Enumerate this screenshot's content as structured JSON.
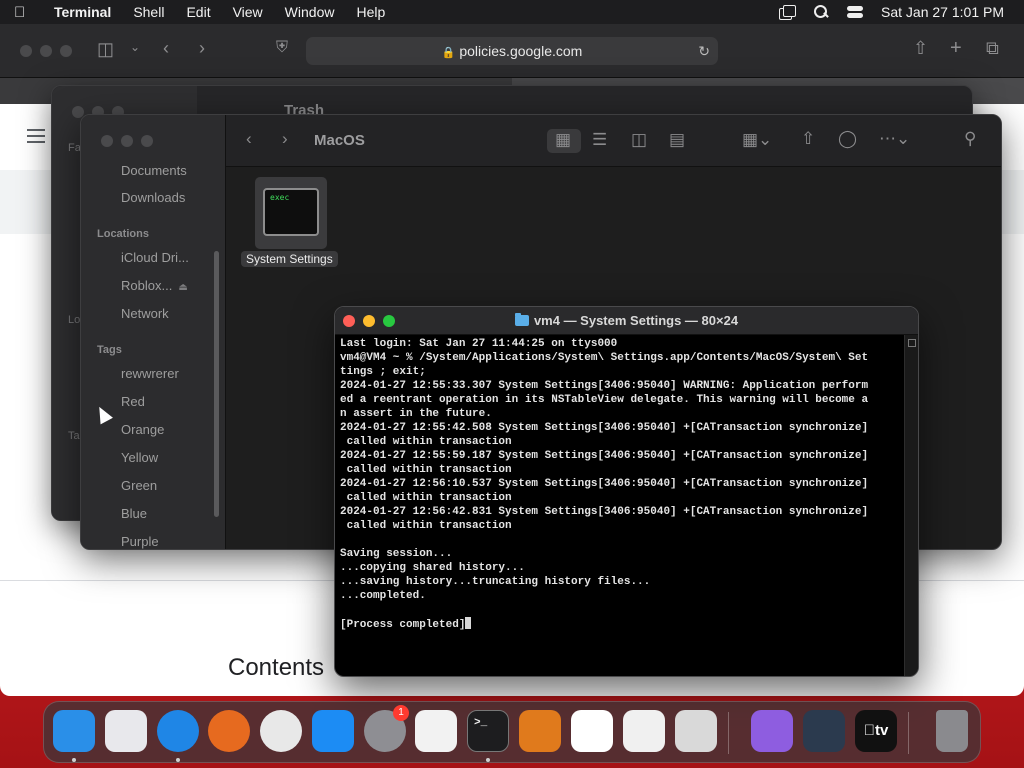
{
  "menubar": {
    "app_name": "Terminal",
    "menus": [
      "Shell",
      "Edit",
      "View",
      "Window",
      "Help"
    ],
    "clock": "Sat Jan 27  1:01 PM"
  },
  "safari": {
    "url": "policies.google.com",
    "contents_heading": "Contents"
  },
  "finder_back": {
    "title": "Trash",
    "sidebar_fragments": [
      "Fa",
      "Lo",
      "Ta"
    ]
  },
  "finder_front": {
    "title": "MacOS",
    "sidebar": {
      "favorites": [
        "Documents",
        "Downloads"
      ],
      "locations_header": "Locations",
      "locations": [
        "iCloud Dri...",
        "Roblox...",
        "Network"
      ],
      "tags_header": "Tags",
      "tags": [
        "rewwrerer",
        "Red",
        "Orange",
        "Yellow",
        "Green",
        "Blue",
        "Purple"
      ]
    },
    "file": {
      "icon_text": "exec",
      "name": "System Settings"
    }
  },
  "terminal": {
    "title": "vm4 — System Settings — 80×24",
    "lines": [
      "Last login: Sat Jan 27 11:44:25 on ttys000",
      "vm4@VM4 ~ % /System/Applications/System\\ Settings.app/Contents/MacOS/System\\ Set",
      "tings ; exit;",
      "2024-01-27 12:55:33.307 System Settings[3406:95040] WARNING: Application perform",
      "ed a reentrant operation in its NSTableView delegate. This warning will become a",
      "n assert in the future.",
      "2024-01-27 12:55:42.508 System Settings[3406:95040] +[CATransaction synchronize]",
      " called within transaction",
      "2024-01-27 12:55:59.187 System Settings[3406:95040] +[CATransaction synchronize]",
      " called within transaction",
      "2024-01-27 12:56:10.537 System Settings[3406:95040] +[CATransaction synchronize]",
      " called within transaction",
      "2024-01-27 12:56:42.831 System Settings[3406:95040] +[CATransaction synchronize]",
      " called within transaction",
      "",
      "Saving session...",
      "...copying shared history...",
      "...saving history...truncating history files...",
      "...completed.",
      "",
      "[Process completed]"
    ]
  },
  "dock": {
    "badge_count": "1",
    "app_tv_label": "tv",
    "icons": [
      {
        "name": "finder-icon",
        "color": "#2a8fe8",
        "running": true
      },
      {
        "name": "launchpad-icon",
        "color": "#e8e8ec",
        "running": false
      },
      {
        "name": "safari-icon",
        "color": "#1f86e6",
        "running": true
      },
      {
        "name": "firefox-icon",
        "color": "#e66a1f",
        "running": false
      },
      {
        "name": "chrome-icon",
        "color": "#e8e8e8",
        "running": false
      },
      {
        "name": "app-store-icon",
        "color": "#1c8cf4",
        "running": false
      },
      {
        "name": "system-settings-icon",
        "color": "#8e8e93",
        "running": false
      },
      {
        "name": "textedit-icon",
        "color": "#f2f2f2",
        "running": false
      },
      {
        "name": "terminal-icon",
        "color": "#1d1d1f",
        "running": true
      },
      {
        "name": "garageband-icon",
        "color": "#e07a1c",
        "running": false
      },
      {
        "name": "vscode-icon",
        "color": "#ffffff",
        "running": false
      },
      {
        "name": "bartender-icon",
        "color": "#f0f0f0",
        "running": false
      },
      {
        "name": "roblox-icon",
        "color": "#d9d9d9",
        "running": false
      },
      {
        "name": "visual-studio-icon",
        "color": "#8e5de0",
        "running": false
      },
      {
        "name": "audio-app-icon",
        "color": "#2b3a4e",
        "running": false
      },
      {
        "name": "apple-tv-icon",
        "color": "#111111",
        "running": false
      },
      {
        "name": "trash-icon",
        "color": "#8a8a8e",
        "running": false
      }
    ]
  }
}
